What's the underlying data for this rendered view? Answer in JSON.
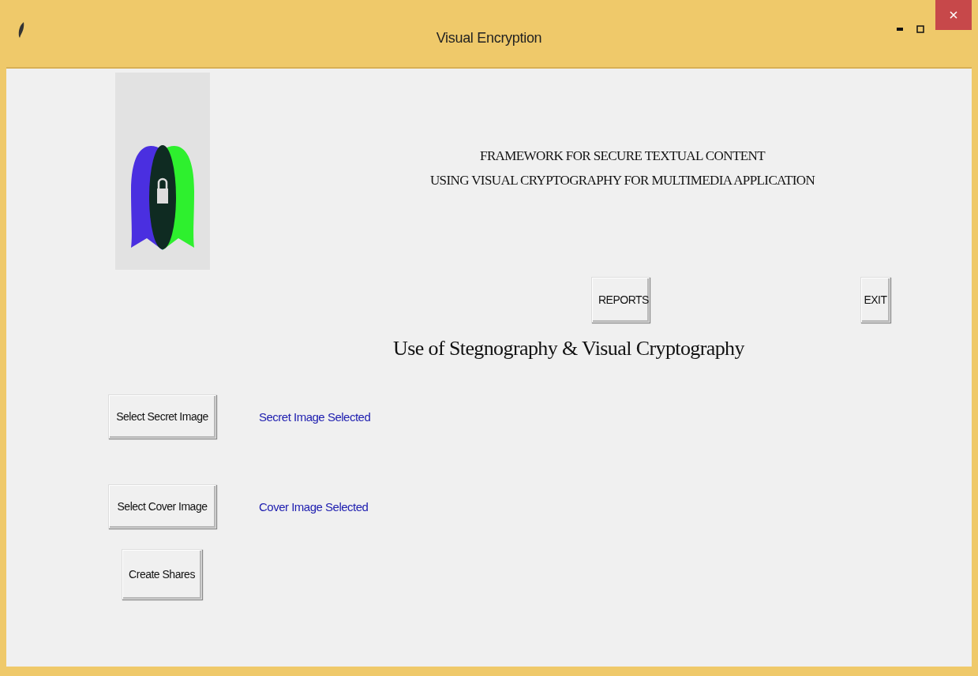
{
  "window": {
    "title": "Visual Encryption"
  },
  "heading": [
    "FRAMEWORK FOR SECURE TEXTUAL CONTENT",
    "USING VISUAL CRYPTOGRAPHY FOR MULTIMEDIA APPLICATION"
  ],
  "top_buttons": [
    "REPORTS",
    "EXIT"
  ],
  "subtitle": "Use of Stegnography & Visual Cryptography",
  "actions": [
    {
      "button": "Select Secret Image",
      "status": "Secret Image Selected"
    },
    {
      "button": "Select Cover Image",
      "status": "Cover Image Selected"
    },
    {
      "button": "Create Shares"
    }
  ]
}
